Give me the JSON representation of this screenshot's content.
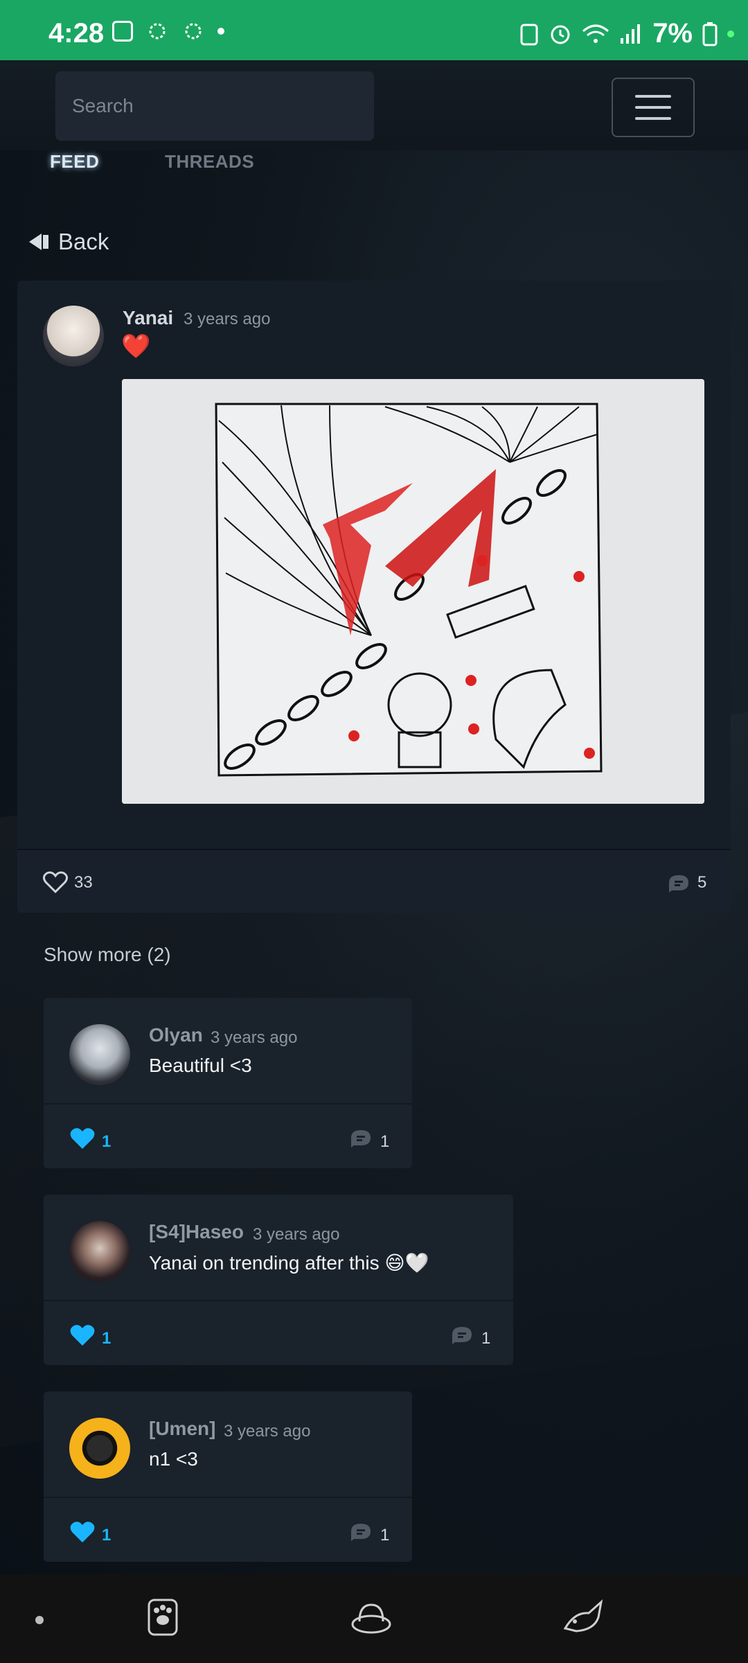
{
  "status_bar": {
    "time": "4:28",
    "battery": "7%"
  },
  "header": {
    "search_placeholder": "Search"
  },
  "tabs": [
    {
      "label": "FEED"
    },
    {
      "label": "THREADS"
    }
  ],
  "back_label": "Back",
  "post": {
    "author": "Yanai",
    "time": "3 years ago",
    "text": "❤️",
    "likes": "33",
    "comments": "5"
  },
  "show_more": "Show more (2)",
  "comments": [
    {
      "author": "Olyan",
      "time": "3 years ago",
      "text": "Beautiful <3",
      "likes": "1",
      "replies": "1"
    },
    {
      "author": "[S4]Haseo",
      "time": "3 years ago",
      "text": "Yanai on trending after this 😄🤍",
      "likes": "1",
      "replies": "1"
    },
    {
      "author": "[Umen]",
      "time": "3 years ago",
      "text": "n1 <3",
      "likes": "1",
      "replies": "1"
    }
  ],
  "colors": {
    "status_bar": "#1aa763",
    "like_active": "#1ab5ff",
    "card": "#1a222b"
  },
  "icons": [
    "image-icon",
    "flower-icon",
    "alarm-icon",
    "wifi-icon",
    "signal-icon",
    "battery-icon",
    "heart-icon",
    "comment-icon",
    "paw-icon",
    "hat-icon",
    "fox-icon"
  ]
}
